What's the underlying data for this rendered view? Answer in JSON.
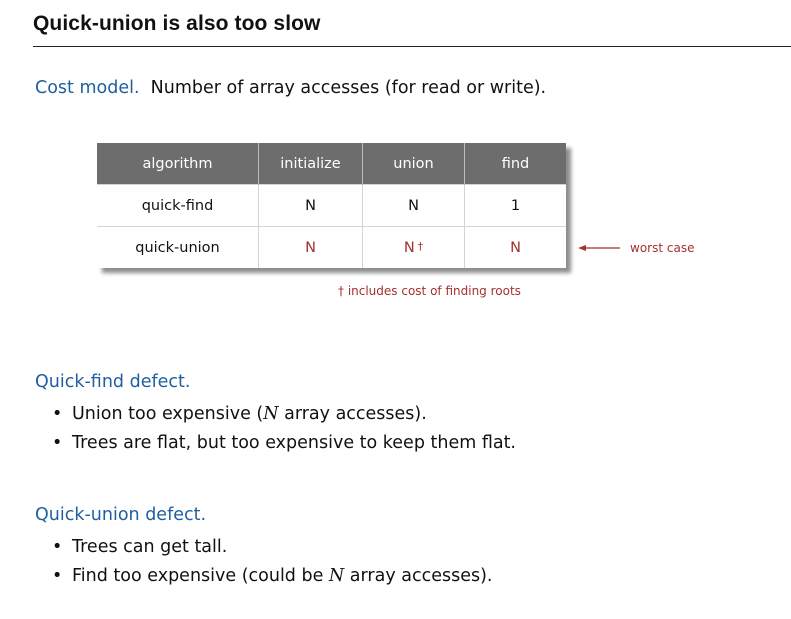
{
  "title": "Quick-union is also too slow",
  "cost_model": {
    "label": "Cost model.",
    "text": "Number of array accesses (for read or write)."
  },
  "table": {
    "headers": [
      "algorithm",
      "initialize",
      "union",
      "find"
    ],
    "rows": [
      {
        "algorithm": "quick-find",
        "initialize": "N",
        "union": "N",
        "union_mark": "",
        "find": "1"
      },
      {
        "algorithm": "quick-union",
        "initialize": "N",
        "union": "N",
        "union_mark": "†",
        "find": "N"
      }
    ],
    "worst_case_label": "worst case",
    "footnote": "† includes cost of finding roots"
  },
  "quick_find_defect": {
    "heading": "Quick-find defect.",
    "bullets": [
      {
        "before": "Union too expensive (",
        "math": "N",
        "after": " array accesses)."
      },
      {
        "before": "Trees are flat, but too expensive to keep them flat.",
        "math": "",
        "after": ""
      }
    ]
  },
  "quick_union_defect": {
    "heading": "Quick-union defect.",
    "bullets": [
      {
        "before": "Trees can get tall.",
        "math": "",
        "after": ""
      },
      {
        "before": "Find too expensive (could be ",
        "math": "N",
        "after": " array accesses)."
      }
    ]
  },
  "bullet_char": "•",
  "colors": {
    "heading_blue": "#1f5f9e",
    "accent_red": "#a3322e",
    "table_header_gray": "#6d6d6d"
  },
  "icons": {
    "worst_case_arrow": "left-arrow-icon"
  }
}
